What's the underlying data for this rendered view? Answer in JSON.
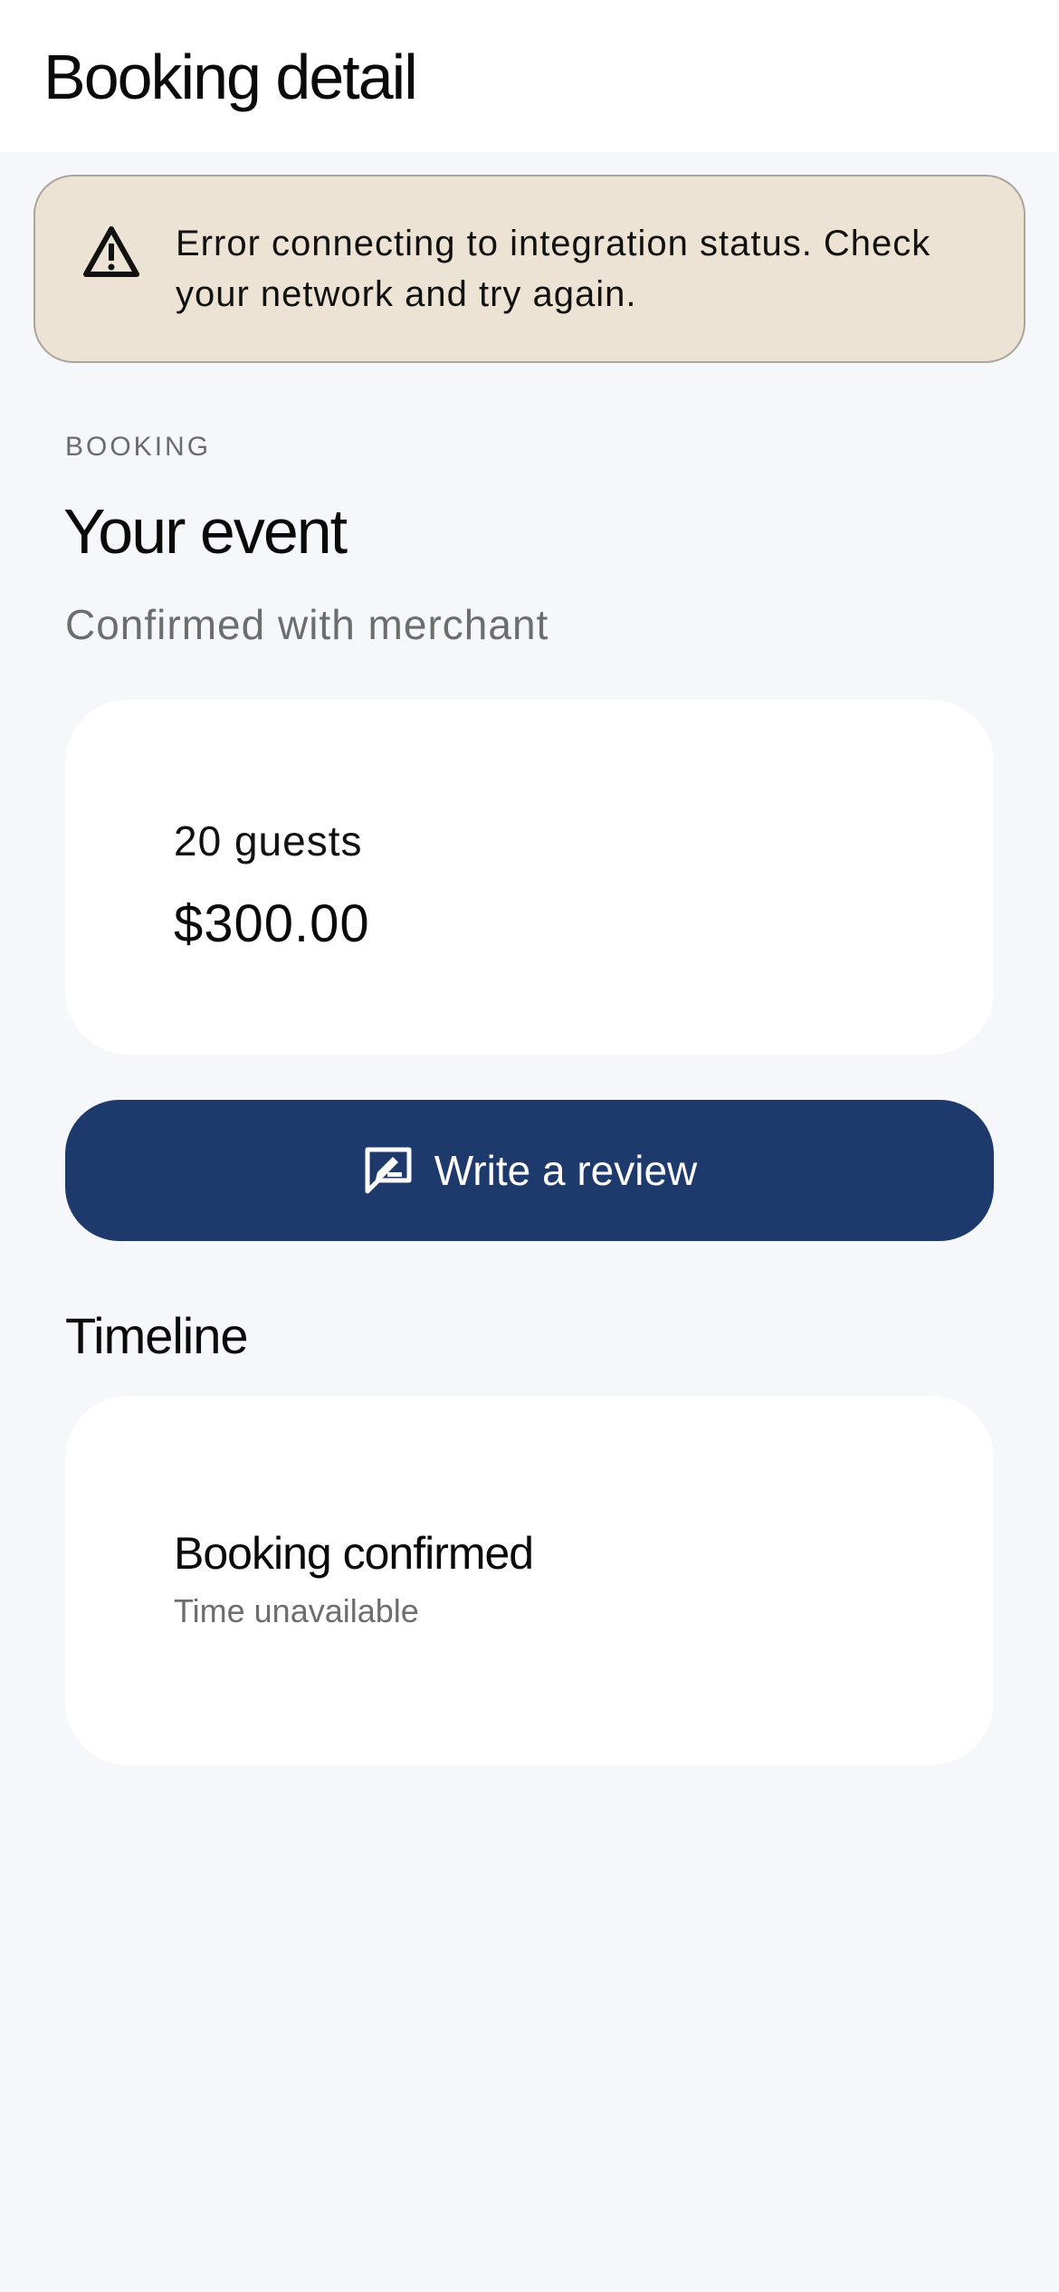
{
  "header": {
    "title": "Booking detail"
  },
  "error_banner": {
    "icon": "warning-icon",
    "message": "Error connecting to integration status. Check your network and try again."
  },
  "booking": {
    "eyebrow": "BOOKING",
    "title": "Your event",
    "subtitle": "Confirmed with merchant",
    "guests": "20 guests",
    "price": "$300.00"
  },
  "actions": {
    "review_icon": "review-icon",
    "review_label": "Write a review"
  },
  "timeline": {
    "title": "Timeline",
    "items": [
      {
        "event": "Booking confirmed",
        "time": "Time unavailable"
      }
    ]
  },
  "colors": {
    "background": "#f6f7fb",
    "banner_background": "#ede3d4",
    "primary_button": "#1e3a6d",
    "muted_text": "#6d6d6d"
  }
}
